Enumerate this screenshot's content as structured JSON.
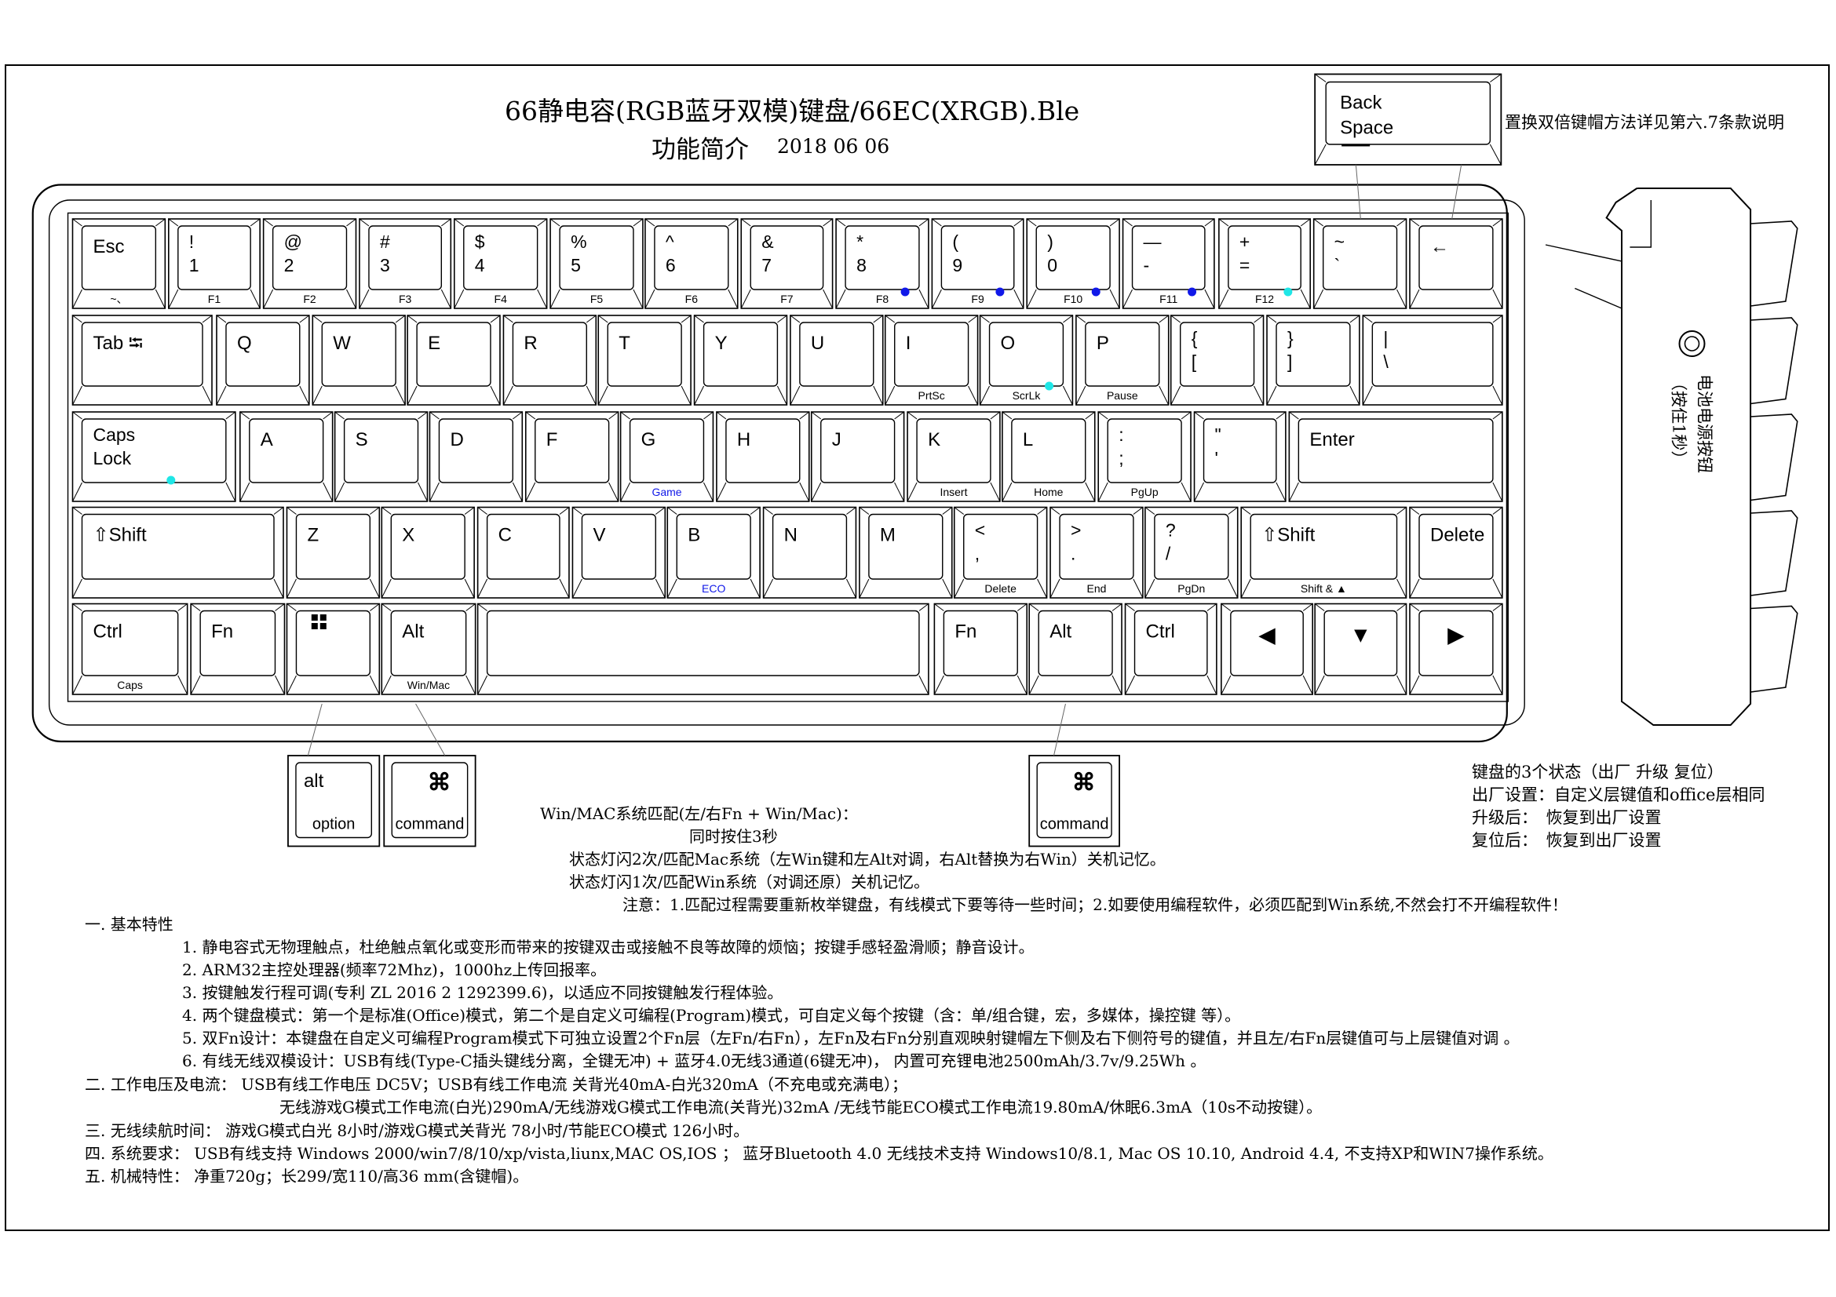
{
  "header": {
    "title": "66静电容(RGB蓝牙双模)键盘/66EC(XRGB).Ble",
    "subtitle_label": "功能简介",
    "date": "2018 06 06",
    "backspace_key": [
      "Back",
      "Space"
    ],
    "backspace_note": "置换双倍键帽方法详见第六.7条款说明"
  },
  "keyboard": {
    "rows": [
      [
        {
          "legend": [
            "Esc"
          ],
          "fn": "~、",
          "color": ""
        },
        {
          "legend": [
            "!",
            "1"
          ],
          "fn": "F1",
          "color": ""
        },
        {
          "legend": [
            "@",
            "2"
          ],
          "fn": "F2",
          "color": ""
        },
        {
          "legend": [
            "#",
            "3"
          ],
          "fn": "F3",
          "color": ""
        },
        {
          "legend": [
            "$",
            "4"
          ],
          "fn": "F4",
          "color": ""
        },
        {
          "legend": [
            "%",
            "5"
          ],
          "fn": "F5",
          "color": ""
        },
        {
          "legend": [
            "^",
            "6"
          ],
          "fn": "F6",
          "color": ""
        },
        {
          "legend": [
            "&",
            "7"
          ],
          "fn": "F7",
          "color": ""
        },
        {
          "legend": [
            "*",
            "8"
          ],
          "fn": "F8",
          "color": ""
        },
        {
          "legend": [
            "(",
            "9"
          ],
          "fn": "F9",
          "color": ""
        },
        {
          "legend": [
            ")",
            "0"
          ],
          "fn": "F10",
          "color": ""
        },
        {
          "legend": [
            "—",
            "-"
          ],
          "fn": "F11",
          "color": ""
        },
        {
          "legend": [
            "+",
            "="
          ],
          "fn": "F12",
          "color": ""
        },
        {
          "legend": [
            "~",
            "`"
          ],
          "fn": "",
          "color": ""
        },
        {
          "legend": [
            "←"
          ],
          "fn": "",
          "color": ""
        }
      ],
      [
        {
          "legend": [
            "Tab ⭾"
          ],
          "fn": "",
          "color": ""
        },
        {
          "legend": [
            "Q"
          ],
          "fn": "",
          "color": ""
        },
        {
          "legend": [
            "W"
          ],
          "fn": "",
          "color": ""
        },
        {
          "legend": [
            "E"
          ],
          "fn": "",
          "color": ""
        },
        {
          "legend": [
            "R"
          ],
          "fn": "",
          "color": ""
        },
        {
          "legend": [
            "T"
          ],
          "fn": "",
          "color": ""
        },
        {
          "legend": [
            "Y"
          ],
          "fn": "",
          "color": ""
        },
        {
          "legend": [
            "U"
          ],
          "fn": "",
          "color": ""
        },
        {
          "legend": [
            "I"
          ],
          "fn": "PrtSc",
          "color": ""
        },
        {
          "legend": [
            "O"
          ],
          "fn": "ScrLk",
          "color": ""
        },
        {
          "legend": [
            "P"
          ],
          "fn": "Pause",
          "color": ""
        },
        {
          "legend": [
            "{",
            "["
          ],
          "fn": "",
          "color": ""
        },
        {
          "legend": [
            "}",
            "]"
          ],
          "fn": "",
          "color": ""
        },
        {
          "legend": [
            "|",
            "\\"
          ],
          "fn": "",
          "color": ""
        }
      ],
      [
        {
          "legend": [
            "Caps",
            "Lock"
          ],
          "fn": "",
          "color": ""
        },
        {
          "legend": [
            "A"
          ],
          "fn": "",
          "color": ""
        },
        {
          "legend": [
            "S"
          ],
          "fn": "",
          "color": ""
        },
        {
          "legend": [
            "D"
          ],
          "fn": "",
          "color": ""
        },
        {
          "legend": [
            "F"
          ],
          "fn": "",
          "color": ""
        },
        {
          "legend": [
            "G"
          ],
          "fn": "Game",
          "color": "blue"
        },
        {
          "legend": [
            "H"
          ],
          "fn": "",
          "color": ""
        },
        {
          "legend": [
            "J"
          ],
          "fn": "",
          "color": ""
        },
        {
          "legend": [
            "K"
          ],
          "fn": "Insert",
          "color": ""
        },
        {
          "legend": [
            "L"
          ],
          "fn": "Home",
          "color": ""
        },
        {
          "legend": [
            ":",
            ";"
          ],
          "fn": "PgUp",
          "color": ""
        },
        {
          "legend": [
            "\"",
            "'"
          ],
          "fn": "",
          "color": ""
        },
        {
          "legend": [
            "Enter"
          ],
          "fn": "",
          "color": ""
        }
      ],
      [
        {
          "legend": [
            "⇧Shift"
          ],
          "fn": "",
          "color": ""
        },
        {
          "legend": [
            "Z"
          ],
          "fn": "",
          "color": ""
        },
        {
          "legend": [
            "X"
          ],
          "fn": "",
          "color": ""
        },
        {
          "legend": [
            "C"
          ],
          "fn": "",
          "color": ""
        },
        {
          "legend": [
            "V"
          ],
          "fn": "",
          "color": ""
        },
        {
          "legend": [
            "B"
          ],
          "fn": "ECO",
          "color": "blue"
        },
        {
          "legend": [
            "N"
          ],
          "fn": "",
          "color": ""
        },
        {
          "legend": [
            "M"
          ],
          "fn": "",
          "color": ""
        },
        {
          "legend": [
            "<",
            ","
          ],
          "fn": "Delete",
          "color": ""
        },
        {
          "legend": [
            ">",
            "."
          ],
          "fn": "End",
          "color": ""
        },
        {
          "legend": [
            "?",
            "/"
          ],
          "fn": "PgDn",
          "color": ""
        },
        {
          "legend": [
            "⇧Shift"
          ],
          "fn": "Shift & ▲",
          "color": ""
        },
        {
          "legend": [
            "Delete"
          ],
          "fn": "",
          "color": ""
        }
      ],
      [
        {
          "legend": [
            "Ctrl"
          ],
          "fn": "Caps",
          "color": ""
        },
        {
          "legend": [
            "Fn"
          ],
          "fn": "",
          "color": ""
        },
        {
          "legend": [
            ""
          ],
          "fn": "",
          "color": ""
        },
        {
          "legend": [
            "Alt"
          ],
          "fn": "Win/Mac",
          "color": ""
        },
        {
          "legend": [
            ""
          ],
          "fn": "",
          "color": ""
        },
        {
          "legend": [
            "Fn"
          ],
          "fn": "",
          "color": ""
        },
        {
          "legend": [
            "Alt"
          ],
          "fn": "",
          "color": ""
        },
        {
          "legend": [
            "Ctrl"
          ],
          "fn": "",
          "color": ""
        },
        {
          "legend": [
            "◀"
          ],
          "fn": "",
          "color": ""
        },
        {
          "legend": [
            "▼"
          ],
          "fn": "",
          "color": ""
        },
        {
          "legend": [
            "▶"
          ],
          "fn": "",
          "color": ""
        }
      ]
    ],
    "mac_keys": [
      {
        "top": "alt",
        "bottom": "option"
      },
      {
        "top": "⌘",
        "bottom": "command"
      },
      {
        "top": "⌘",
        "bottom": "command"
      }
    ],
    "side_label": [
      "电池电源按钮",
      "（按住1秒）"
    ]
  },
  "accent_colors": {
    "blue_led": "#1018e8",
    "cyan_led": "#1fe6e6",
    "yellow": "#f0e040",
    "red_icon": "#e03030"
  },
  "states": {
    "title": "键盘的3个状态（出厂 升级 复位）",
    "lines": [
      "出厂设置：自定义层键值和office层相同",
      "升级后：　恢复到出厂设置",
      "复位后：　恢复到出厂设置"
    ]
  },
  "pairing": {
    "line1": "Win/MAC系统匹配(左/右Fn + Win/Mac)：",
    "line2": "同时按住3秒",
    "line3": "状态灯闪2次/匹配Mac系统（左Win键和左Alt对调，右Alt替换为右Win）关机记忆。",
    "line4": "状态灯闪1次/匹配Win系统（对调还原）关机记忆。",
    "note": "注意：1.匹配过程需要重新枚举键盘，有线模式下要等待一些时间；2.如要使用编程软件，必须匹配到Win系统,不然会打不开编程软件！"
  },
  "features": {
    "section1": "一. 基本特性",
    "items": [
      "1. 静电容式无物理触点，杜绝触点氧化或变形而带来的按键双击或接触不良等故障的烦恼；按键手感轻盈滑顺；静音设计。",
      "2. ARM32主控处理器(频率72Mhz)，1000hz上传回报率。",
      "3. 按键触发行程可调(专利 ZL 2016 2 1292399.6)，以适应不同按键触发行程体验。",
      "4. 两个键盘模式：第一个是标准(Office)模式，第二个是自定义可编程(Program)模式，可自定义每个按键（含：单/组合键，宏，多媒体，操控键 等）。",
      "5. 双Fn设计：本键盘在自定义可编程Program模式下可独立设置2个Fn层（左Fn/右Fn），左Fn及右Fn分别直观映射键帽左下侧及右下侧符号的键值，并且左/右Fn层键值可与上层键值对调 。",
      "6. 有线无线双模设计：USB有线(Type-C插头键线分离，全键无冲) + 蓝牙4.0无线3通道(6键无冲)， 内置可充锂电池2500mAh/3.7v/9.25Wh 。"
    ],
    "section2": "二. 工作电压及电流：  USB有线工作电压 DC5V；USB有线工作电流 关背光40mA-白光320mA（不充电或充满电）；",
    "section2_line2": "无线游戏G模式工作电流(白光)290mA/无线游戏G模式工作电流(关背光)32mA /无线节能ECO模式工作电流19.80mA/休眠6.3mA（10s不动按键）。",
    "section3": "三. 无线续航时间：  游戏G模式白光 8小时/游戏G模式关背光 78小时/节能ECO模式 126小时。",
    "section4": "四. 系统要求：  USB有线支持 Windows 2000/win7/8/10/xp/vista,liunx,MAC OS,IOS ；  蓝牙Bluetooth 4.0 无线技术支持 Windows10/8.1, Mac OS 10.10, Android 4.4,  不支持XP和WIN7操作系统。",
    "section5": "五. 机械特性：  净重720g；长299/宽110/高36 mm(含键帽)。"
  }
}
